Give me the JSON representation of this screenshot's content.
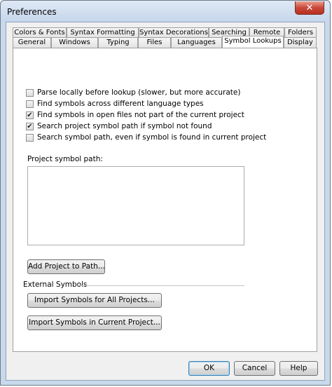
{
  "window": {
    "title": "Preferences",
    "close_glyph": "✕"
  },
  "tabs": {
    "row_top": [
      "Colors & Fonts",
      "Syntax Formatting",
      "Syntax Decorations",
      "Searching",
      "Remote",
      "Folders"
    ],
    "row_bottom": [
      "General",
      "Windows",
      "Typing",
      "Files",
      "Languages",
      "Symbol Lookups",
      "Display"
    ],
    "active": "Symbol Lookups"
  },
  "options": [
    {
      "label": "Parse locally before lookup (slower, but more accurate)",
      "checked": false
    },
    {
      "label": "Find symbols across different language types",
      "checked": false
    },
    {
      "label": "Find symbols in open files not part of the current project",
      "checked": true
    },
    {
      "label": "Search project symbol path if symbol not found",
      "checked": true
    },
    {
      "label": "Search symbol path, even if symbol is found in current project",
      "checked": false
    }
  ],
  "symbol_path": {
    "label": "Project symbol path:",
    "value": ""
  },
  "buttons": {
    "add_project": "Add Project to Path...",
    "import_all": "Import Symbols for All Projects...",
    "import_current": "Import Symbols in Current Project...",
    "ok": "OK",
    "cancel": "Cancel",
    "help": "Help"
  },
  "external_symbols": {
    "label": "External Symbols"
  },
  "check_glyph": "✔"
}
